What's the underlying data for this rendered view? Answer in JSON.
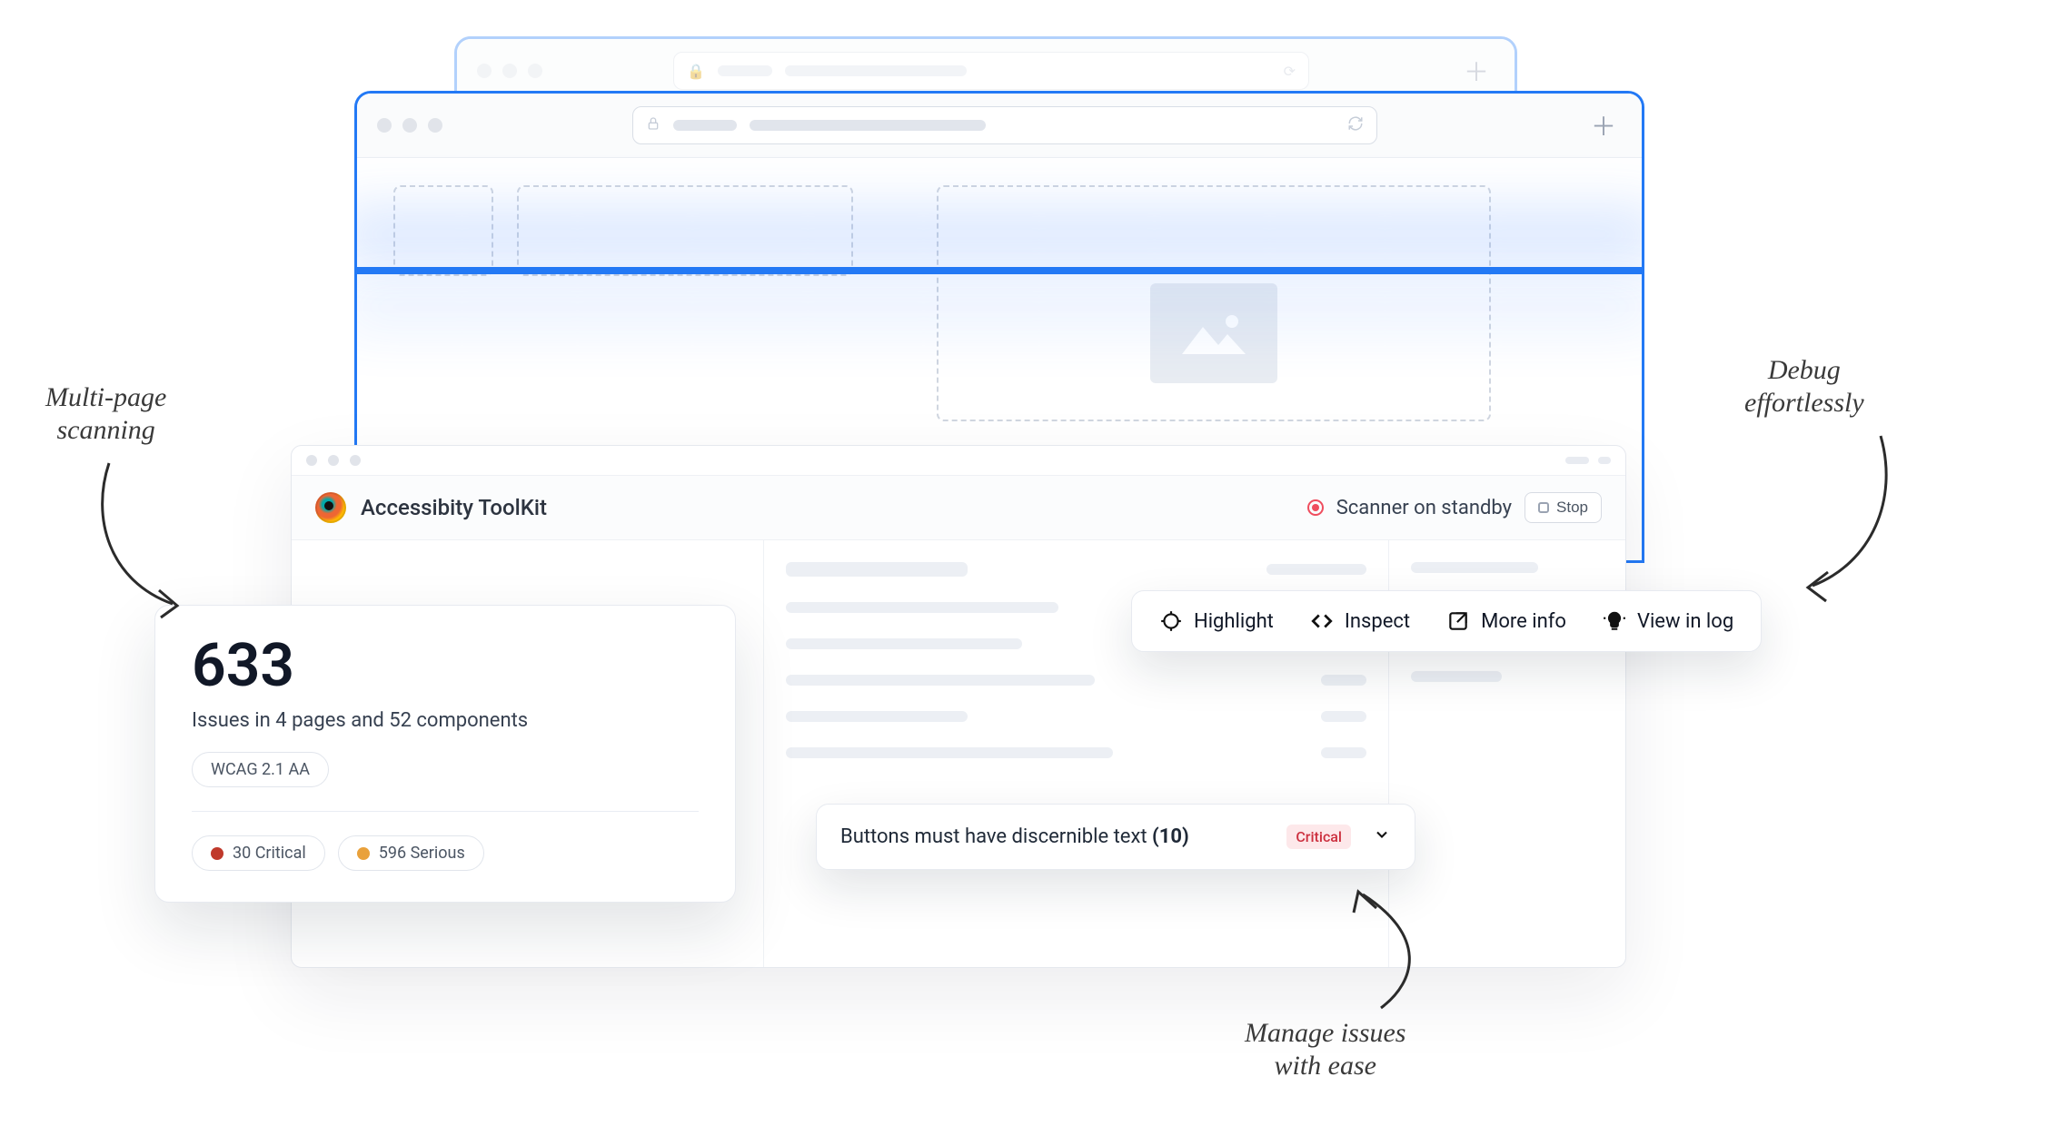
{
  "annotations": {
    "multi_page": "Multi-page\nscanning",
    "debug": "Debug\neffortlessly",
    "manage": "Manage issues\nwith ease"
  },
  "toolkit": {
    "app_name": "Accessibity ToolKit",
    "status_text": "Scanner on standby",
    "stop_label": "Stop"
  },
  "summary": {
    "total": "633",
    "subtext": "Issues in 4 pages and 52 components",
    "wcag_badge": "WCAG 2.1 AA",
    "critical_label": "30 Critical",
    "serious_label": "596 Serious"
  },
  "issue": {
    "title_text": "Buttons must have discernible text ",
    "count": "(10)",
    "severity": "Critical"
  },
  "actions": {
    "highlight": "Highlight",
    "inspect": "Inspect",
    "more_info": "More info",
    "view_log": "View in log"
  }
}
